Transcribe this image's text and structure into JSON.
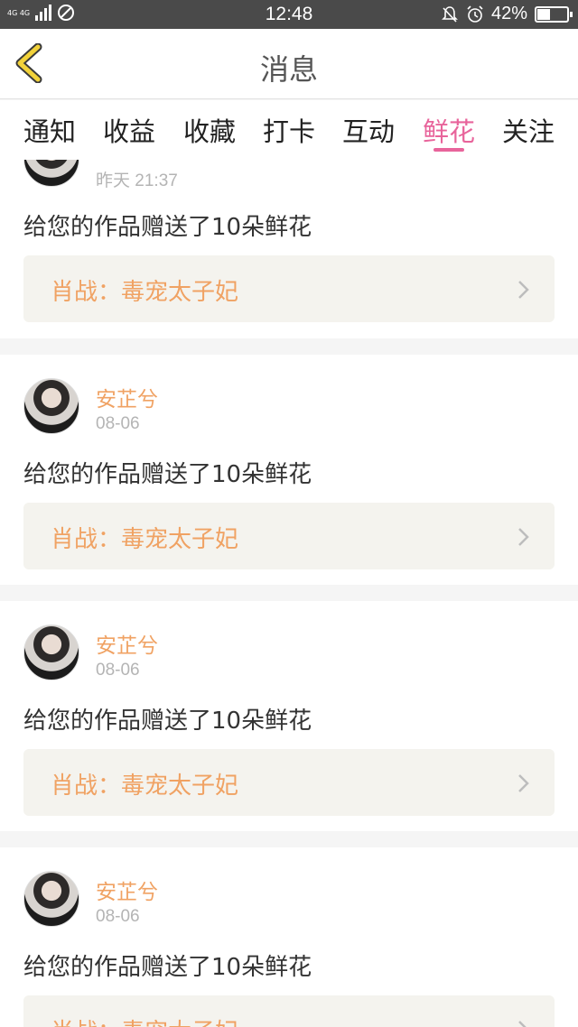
{
  "status_bar": {
    "network": "4G 4G",
    "time": "12:48",
    "battery": "42%",
    "battery_level": 0.42
  },
  "header": {
    "title": "消息",
    "back_icon": "chevron-left-icon"
  },
  "tabs": {
    "items": [
      "通知",
      "收益",
      "收藏",
      "打卡",
      "互动",
      "鲜花",
      "关注"
    ],
    "active": "鲜花"
  },
  "messages": [
    {
      "date": "昨天 21:37",
      "text": "给您的作品赠送了10朵鲜花",
      "work": "肖战：毒宠太子妃"
    },
    {
      "user": "安芷兮",
      "date": "08-06",
      "text": "给您的作品赠送了10朵鲜花",
      "work": "肖战：毒宠太子妃"
    },
    {
      "user": "安芷兮",
      "date": "08-06",
      "text": "给您的作品赠送了10朵鲜花",
      "work": "肖战：毒宠太子妃"
    },
    {
      "user": "安芷兮",
      "date": "08-06",
      "text": "给您的作品赠送了10朵鲜花",
      "work": "肖战：毒宠太子妃"
    }
  ],
  "colors": {
    "accent_pink": "#e8649b",
    "accent_orange": "#f0a263",
    "back_yellow": "#f2d23a"
  }
}
